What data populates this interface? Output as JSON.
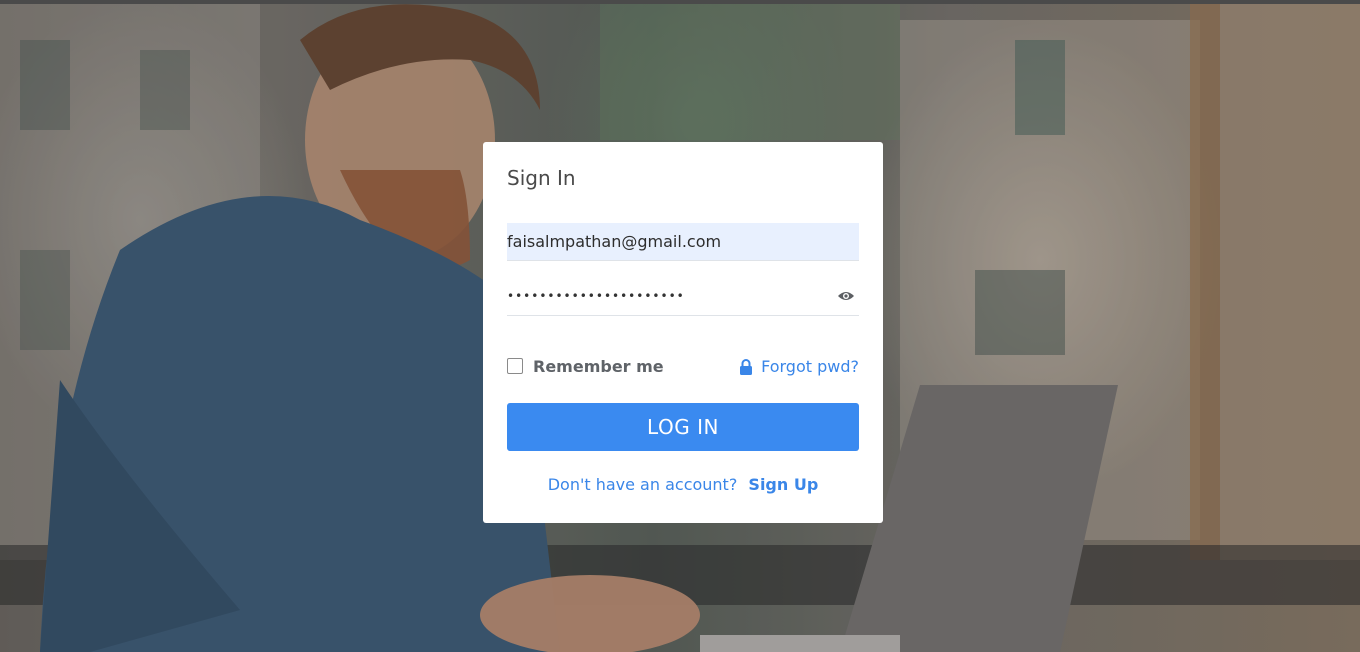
{
  "login": {
    "title": "Sign In",
    "email_value": "faisalmpathan@gmail.com",
    "password_masked": "••••••••••••••••••••••",
    "remember_label": "Remember me",
    "remember_checked": false,
    "forgot_label": "Forgot pwd?",
    "login_button": "LOG IN",
    "signup_prompt": "Don't have an account?",
    "signup_link": "Sign Up"
  },
  "icons": {
    "password_toggle": "eye-icon",
    "forgot": "lock-icon"
  },
  "colors": {
    "accent": "#3a8af0",
    "link": "#3a86e8",
    "autofill_bg": "#e8f0fe"
  }
}
